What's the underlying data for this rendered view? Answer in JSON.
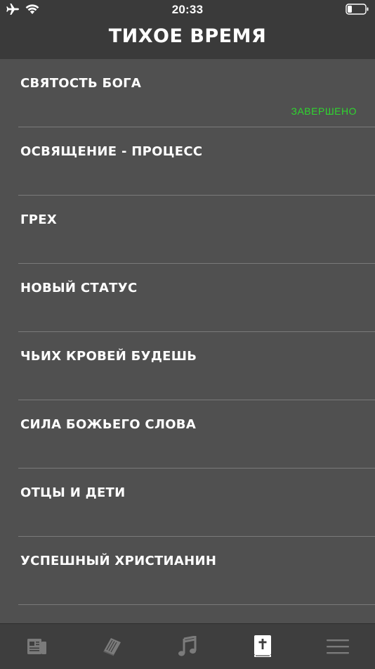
{
  "status_bar": {
    "time": "20:33",
    "icons": [
      "airplane-icon",
      "wifi-icon",
      "battery-icon"
    ]
  },
  "header": {
    "title": "ТИХОЕ ВРЕМЯ"
  },
  "list": {
    "items": [
      {
        "title": "СВЯТОСТЬ БОГА",
        "status": "ЗАВЕРШЕНО"
      },
      {
        "title": "ОСВЯЩЕНИЕ - ПРОЦЕСС",
        "status": ""
      },
      {
        "title": "ГРЕХ",
        "status": ""
      },
      {
        "title": "НОВЫЙ СТАТУС",
        "status": ""
      },
      {
        "title": "ЧЬИХ КРОВЕЙ БУДЕШЬ",
        "status": ""
      },
      {
        "title": "СИЛА БОЖЬЕГО СЛОВА",
        "status": ""
      },
      {
        "title": "ОТЦЫ И ДЕТИ",
        "status": ""
      },
      {
        "title": "УСПЕШНЫЙ ХРИСТИАНИН",
        "status": ""
      }
    ]
  },
  "tabbar": {
    "tabs": [
      {
        "icon": "news-icon",
        "active": false
      },
      {
        "icon": "books-icon",
        "active": false
      },
      {
        "icon": "music-note-icon",
        "active": false
      },
      {
        "icon": "bible-icon",
        "active": true
      },
      {
        "icon": "menu-icon",
        "active": false
      }
    ]
  },
  "colors": {
    "background": "#505050",
    "header_background": "#3a3a3a",
    "tabbar_background": "#3e3e3e",
    "status_completed": "#2fd62f",
    "tab_inactive": "#7b7b7b",
    "tab_active": "#ffffff"
  }
}
